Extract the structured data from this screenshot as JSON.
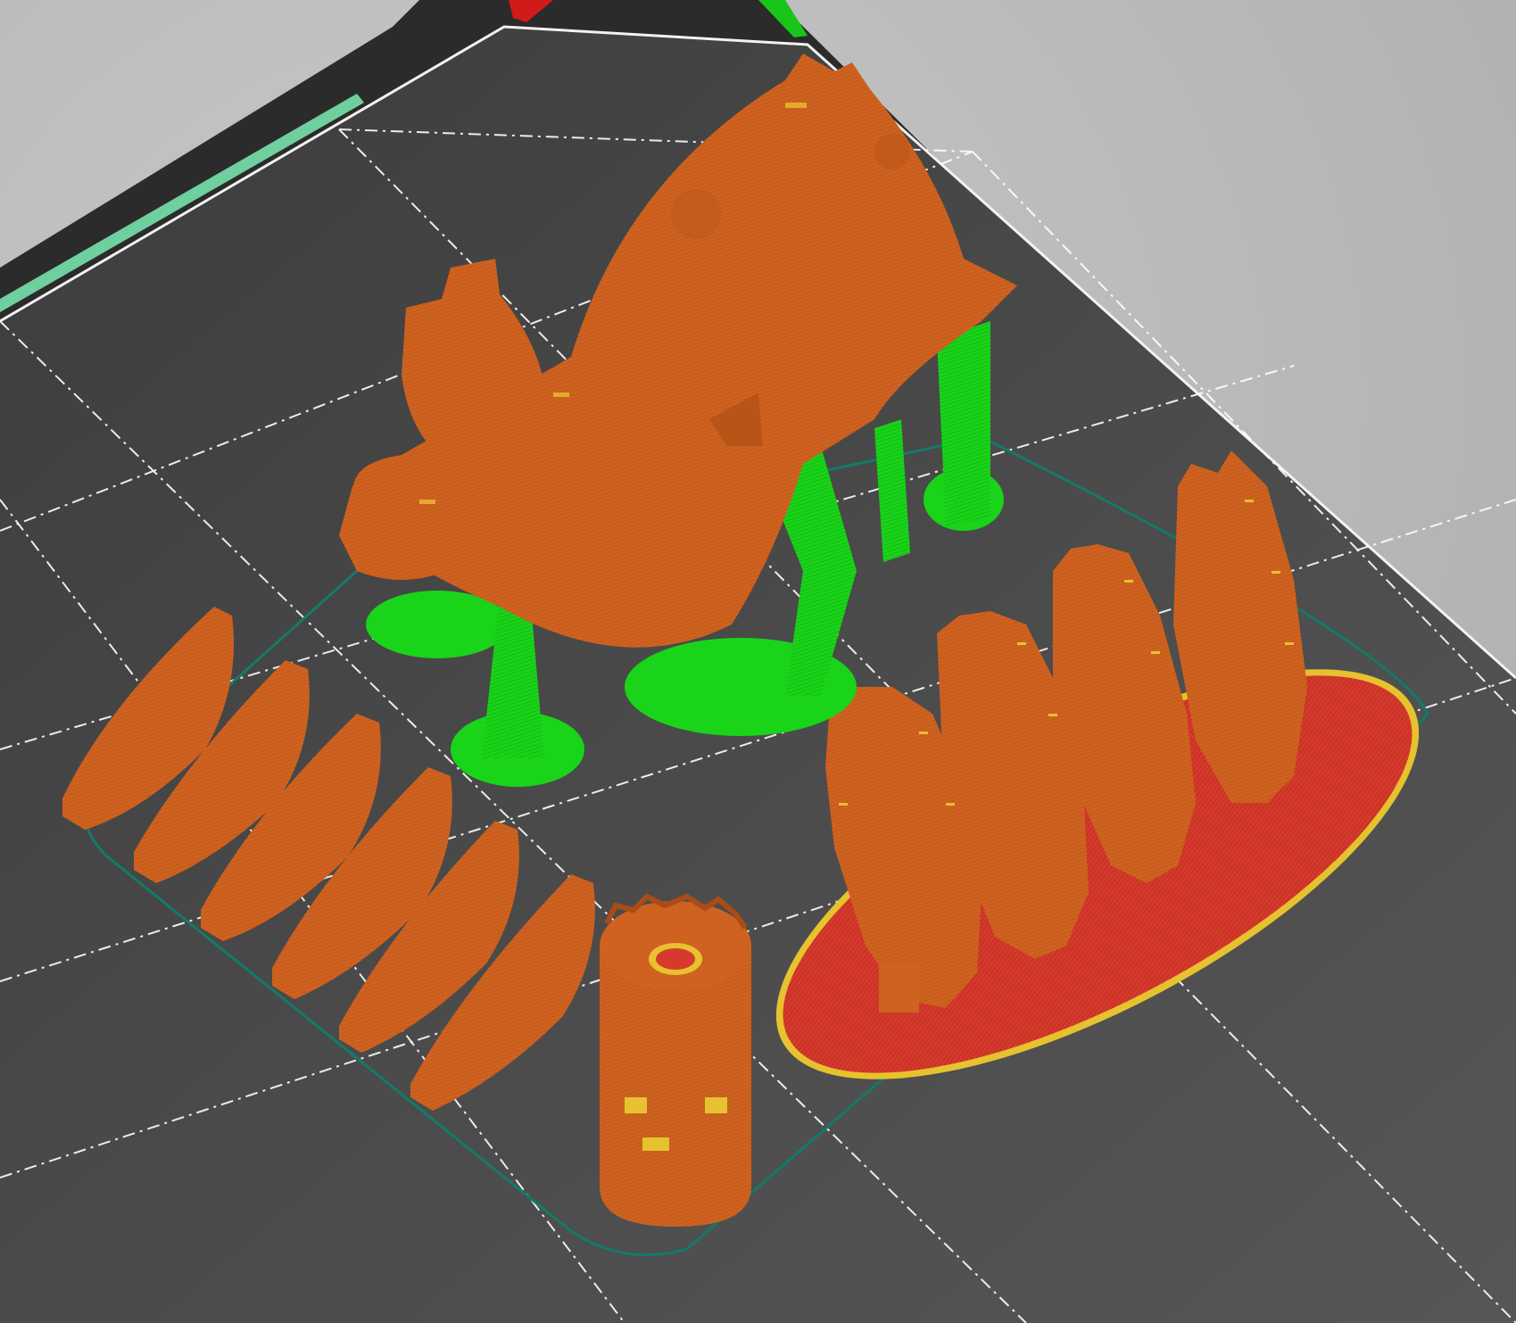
{
  "app": {
    "view": "gcode-preview-3d"
  },
  "colors": {
    "background": "#bdbdbd",
    "bed_frame": "#2b2b2b",
    "bed_surface": "#474747",
    "grid_line": "#ffffff",
    "model_perimeter": "#cf6220",
    "model_perimeter_dark": "#a94c17",
    "support_material": "#19d419",
    "support_dark": "#0f9d0f",
    "brim_raft": "#d63a2c",
    "top_solid_infill": "#e6c22e",
    "skirt": "#137a6a",
    "axis_x": "#d11a1a",
    "axis_y": "#19c519",
    "wipe_tower_line": "#6fcf9e"
  },
  "scene": {
    "objects": [
      {
        "id": "creature-model",
        "type": "figurine-with-supports"
      },
      {
        "id": "wing-pieces",
        "type": "curved-blades",
        "count": 6
      },
      {
        "id": "gear-plates",
        "type": "gear-discs-on-raft",
        "count": 4
      },
      {
        "id": "tower-cylinder",
        "type": "cylinder"
      }
    ]
  }
}
